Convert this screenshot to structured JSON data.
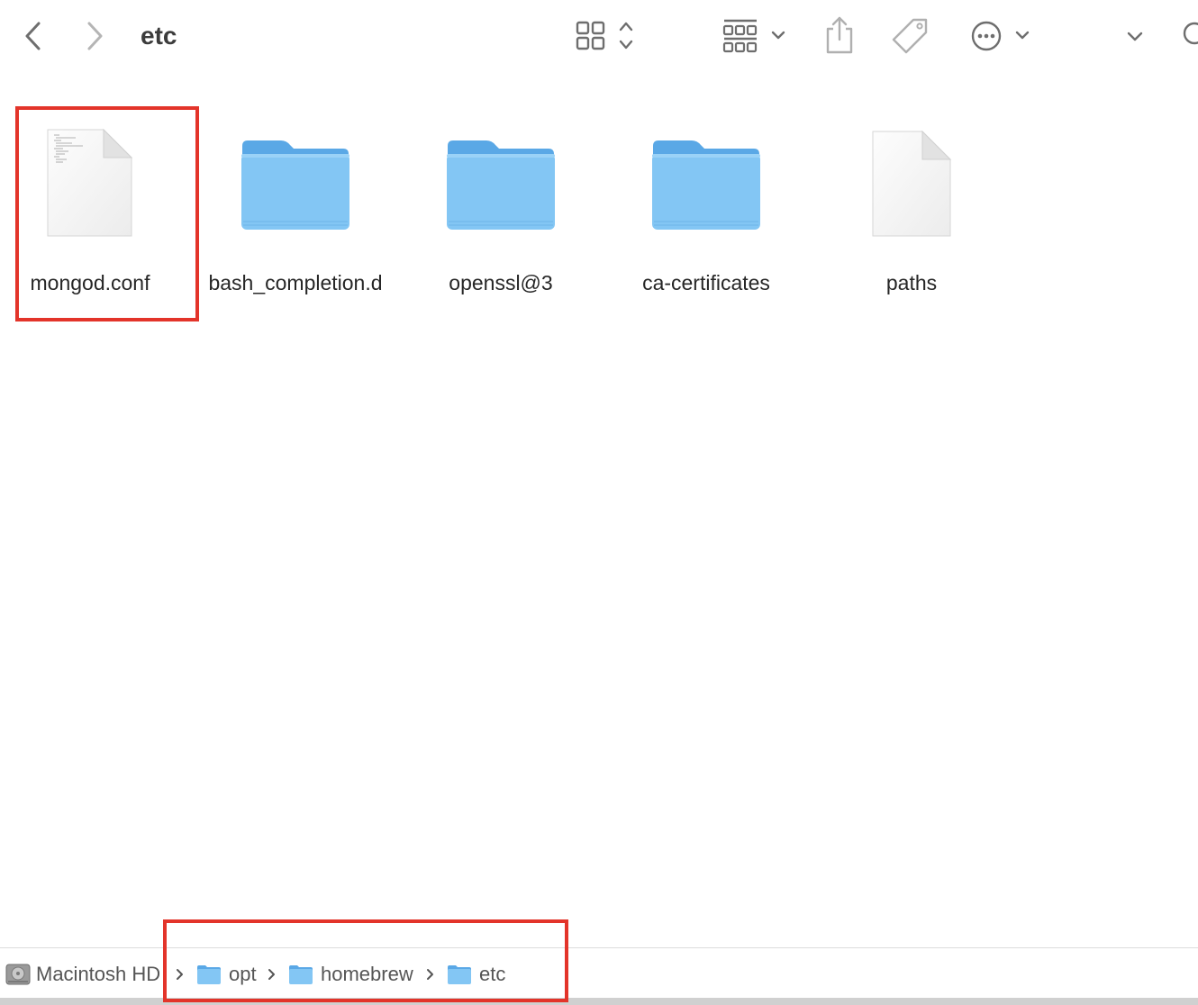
{
  "toolbar": {
    "title": "etc",
    "icons": {
      "back": "chevron-left-icon",
      "forward": "chevron-right-icon",
      "view": "icon-grid-view-icon",
      "group": "group-by-icon",
      "share": "share-icon",
      "tag": "tag-icon",
      "more": "ellipsis-circle-icon",
      "expand": "chevron-down-icon",
      "search": "search-icon"
    }
  },
  "files": [
    {
      "name": "mongod.conf",
      "kind": "text-document"
    },
    {
      "name": "bash_completion.d",
      "kind": "folder"
    },
    {
      "name": "openssl@3",
      "kind": "folder"
    },
    {
      "name": "ca-certificates",
      "kind": "folder"
    },
    {
      "name": "paths",
      "kind": "document"
    }
  ],
  "pathbar": {
    "items": [
      {
        "label": "Macintosh HD",
        "icon": "hard-drive-icon"
      },
      {
        "label": "opt",
        "icon": "folder-icon"
      },
      {
        "label": "homebrew",
        "icon": "folder-icon"
      },
      {
        "label": "etc",
        "icon": "folder-icon"
      }
    ]
  },
  "colors": {
    "folder": "#7cc3f2",
    "folder_tab": "#5aa8e6",
    "highlight": "#e3342a",
    "icon_gray": "#6e6e6e"
  }
}
